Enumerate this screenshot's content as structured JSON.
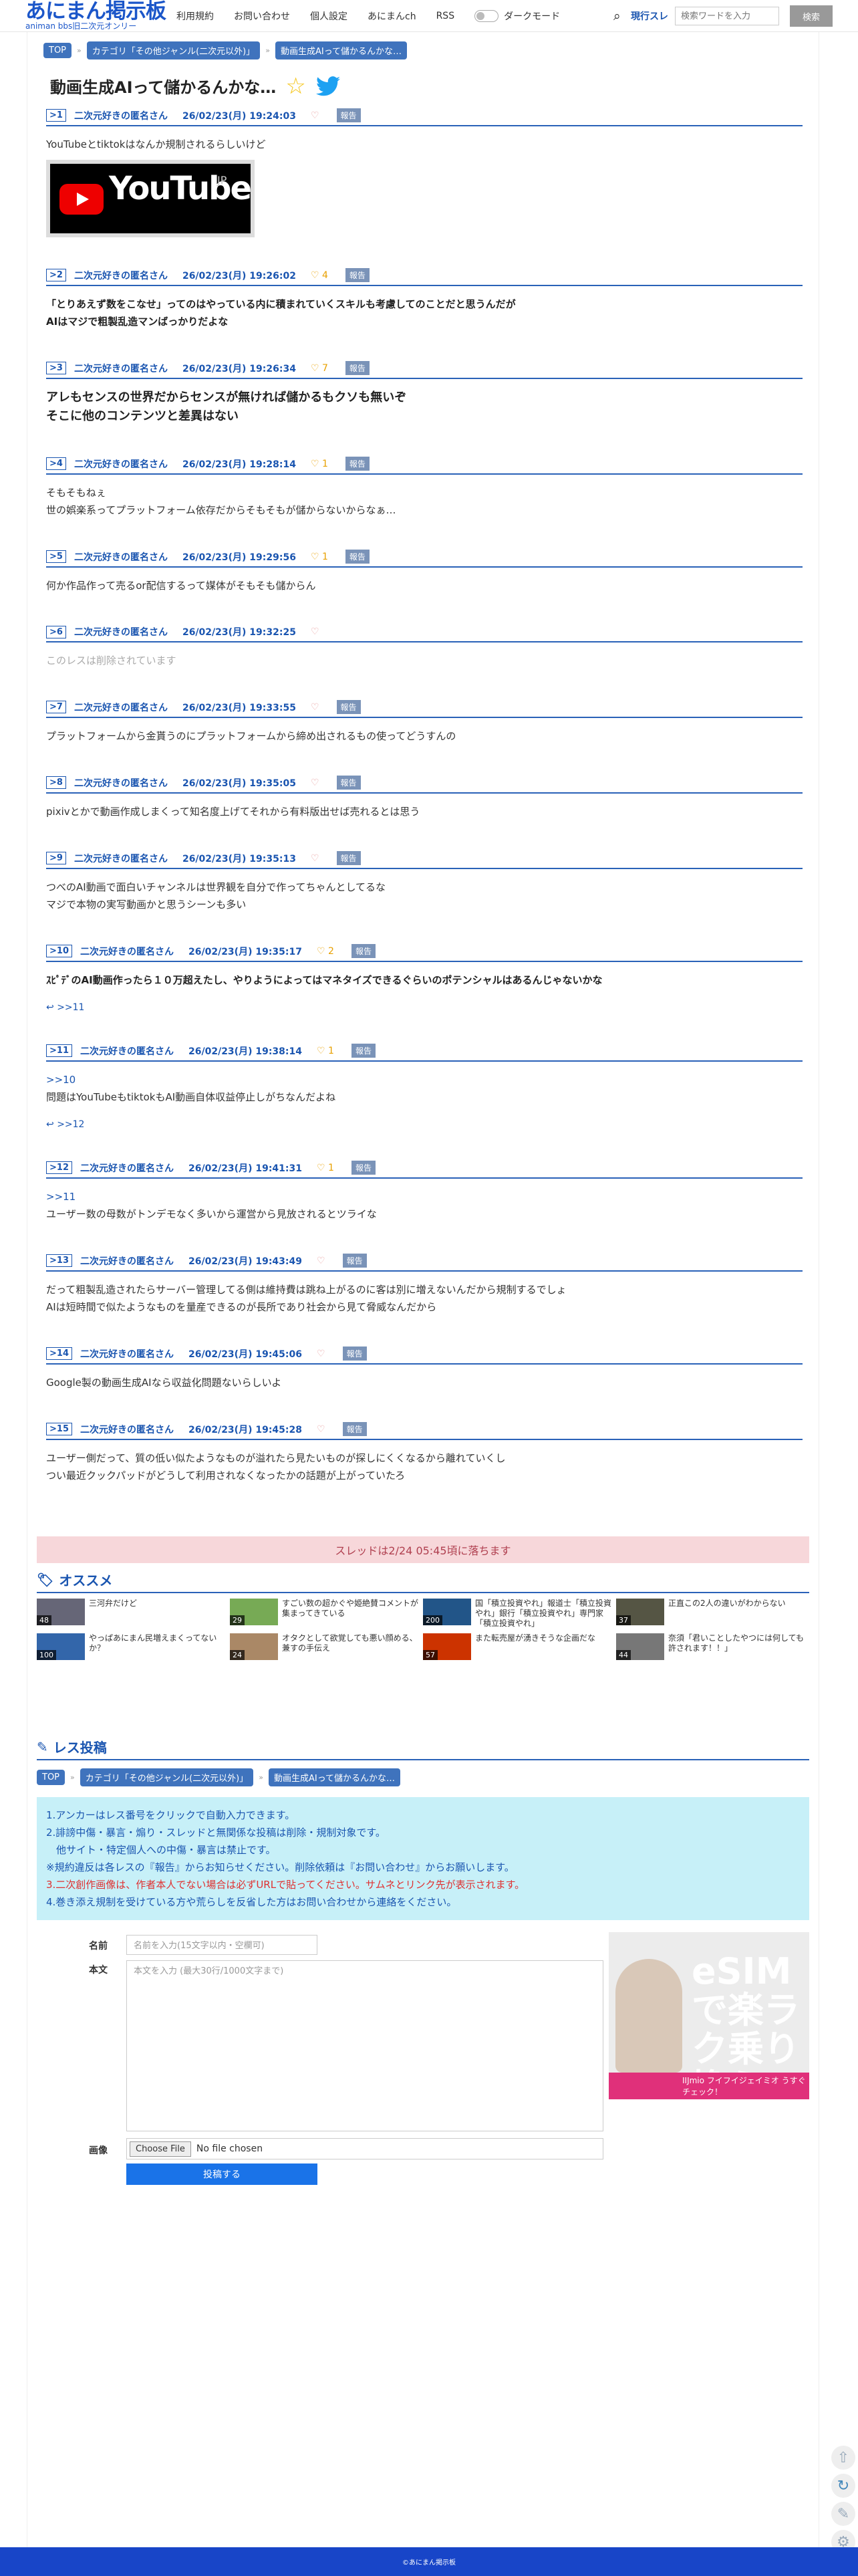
{
  "header": {
    "logo_main": "あにまん掲示板",
    "logo_sub": "animan bbs旧二次元オンリー",
    "nav": [
      "利用規約",
      "お問い合わせ",
      "個人設定",
      "あにまんch",
      "RSS"
    ],
    "dark_mode": "ダークモード",
    "search_scope": "現行スレ",
    "search_placeholder": "検索ワードを入力",
    "search_button": "検索"
  },
  "breadcrumb": [
    "TOP",
    "カテゴリ「その他ジャンル(二次元以外)」",
    "動画生成AIって儲かるんかな…"
  ],
  "breadcrumb_sep": "»",
  "thread_title": "動画生成AIって儲かるんかな…",
  "posts": [
    {
      "num": "1",
      "name": "二次元好きの匿名さん",
      "time": "26/02/23(月) 19:24:03",
      "likes": "",
      "report": "報告",
      "anchor": "",
      "lines": [
        "YouTubeとtiktokはなんか規制されるらしいけど"
      ],
      "image": {
        "brand": "YouTube",
        "region": "JP"
      }
    },
    {
      "num": "2",
      "name": "二次元好きの匿名さん",
      "time": "26/02/23(月) 19:26:02",
      "likes": "4",
      "report": "報告",
      "anchor": "",
      "lines": [
        "「とりあえず数をこなせ」ってのはやっている内に積まれていくスキルも考慮してのことだと思うんだが",
        "AIはマジで粗製乱造マンばっかりだよな"
      ]
    },
    {
      "num": "3",
      "name": "二次元好きの匿名さん",
      "time": "26/02/23(月) 19:26:34",
      "likes": "7",
      "report": "報告",
      "anchor": "",
      "lines": [
        "アレもセンスの世界だからセンスが無ければ儲かるもクソも無いぞ",
        "そこに他のコンテンツと差異はない"
      ]
    },
    {
      "num": "4",
      "name": "二次元好きの匿名さん",
      "time": "26/02/23(月) 19:28:14",
      "likes": "1",
      "report": "報告",
      "anchor": "",
      "lines": [
        "そもそもねぇ",
        "世の娯楽系ってプラットフォーム依存だからそもそもが儲からないからなぁ…"
      ]
    },
    {
      "num": "5",
      "name": "二次元好きの匿名さん",
      "time": "26/02/23(月) 19:29:56",
      "likes": "1",
      "report": "報告",
      "anchor": "",
      "lines": [
        "何か作品作って売るor配信するって媒体がそもそも儲からん"
      ]
    },
    {
      "num": "6",
      "name": "二次元好きの匿名さん",
      "time": "26/02/23(月) 19:32:25",
      "likes": "",
      "report": "",
      "anchor": "",
      "lines": [
        "このレスは削除されています"
      ]
    },
    {
      "num": "7",
      "name": "二次元好きの匿名さん",
      "time": "26/02/23(月) 19:33:55",
      "likes": "",
      "report": "報告",
      "anchor": "",
      "lines": [
        "プラットフォームから金貰うのにプラットフォームから締め出されるもの使ってどうすんの"
      ]
    },
    {
      "num": "8",
      "name": "二次元好きの匿名さん",
      "time": "26/02/23(月) 19:35:05",
      "likes": "",
      "report": "報告",
      "anchor": "",
      "lines": [
        "pixivとかで動画作成しまくって知名度上げてそれから有料版出せば売れるとは思う"
      ]
    },
    {
      "num": "9",
      "name": "二次元好きの匿名さん",
      "time": "26/02/23(月) 19:35:13",
      "likes": "",
      "report": "報告",
      "anchor": "",
      "lines": [
        "つべのAI動画で面白いチャンネルは世界観を自分で作ってちゃんとしてるな",
        "マジで本物の実写動画かと思うシーンも多い"
      ]
    },
    {
      "num": "10",
      "name": "二次元好きの匿名さん",
      "time": "26/02/23(月) 19:35:17",
      "likes": "2",
      "report": "報告",
      "anchor": "",
      "lines": [
        "ｽﾋﾟﾃﾞのAI動画作ったら１０万超えたし、やりようによってはマネタイズできるぐらいのポテンシャルはあるんじゃないかな"
      ],
      "reply": ">>11"
    },
    {
      "num": "11",
      "name": "二次元好きの匿名さん",
      "time": "26/02/23(月) 19:38:14",
      "likes": "1",
      "report": "報告",
      "anchor": ">>10",
      "lines": [
        "問題はYouTubeもtiktokもAI動画自体収益停止しがちなんだよね"
      ],
      "reply": ">>12"
    },
    {
      "num": "12",
      "name": "二次元好きの匿名さん",
      "time": "26/02/23(月) 19:41:31",
      "likes": "1",
      "report": "報告",
      "anchor": ">>11",
      "lines": [
        "ユーザー数の母数がトンデモなく多いから運営から見放されるとツライな"
      ]
    },
    {
      "num": "13",
      "name": "二次元好きの匿名さん",
      "time": "26/02/23(月) 19:43:49",
      "likes": "",
      "report": "報告",
      "anchor": "",
      "lines": [
        "だって粗製乱造されたらサーバー管理してる側は維持費は跳ね上がるのに客は別に増えないんだから規制するでしょ",
        "AIは短時間で似たようなものを量産できるのが長所であり社会から見て脅威なんだから"
      ]
    },
    {
      "num": "14",
      "name": "二次元好きの匿名さん",
      "time": "26/02/23(月) 19:45:06",
      "likes": "",
      "report": "報告",
      "anchor": "",
      "lines": [
        "Google製の動画生成AIなら収益化問題ないらしいよ"
      ]
    },
    {
      "num": "15",
      "name": "二次元好きの匿名さん",
      "time": "26/02/23(月) 19:45:28",
      "likes": "",
      "report": "報告",
      "anchor": "",
      "lines": [
        "ユーザー側だって、質の低い似たようなものが溢れたら見たいものが探しにくくなるから離れていくし",
        "つい最近クックパッドがどうして利用されなくなったかの話題が上がっていたろ"
      ]
    }
  ],
  "notice": "スレッドは2/24 05:45頃に落ちます",
  "recommend": {
    "title": "オススメ",
    "items": [
      {
        "text": "三河弁だけど",
        "count": "48"
      },
      {
        "text": "すごい数の超かぐや姫絶賛コメントが集まってきている",
        "count": "29"
      },
      {
        "text": "国「積立投資やれ」報道士「積立投資やれ」銀行「積立投資やれ」専門家「積立投資やれ」",
        "count": "200"
      },
      {
        "text": "正直この2人の違いがわからない",
        "count": "37"
      },
      {
        "text": "やっぱあにまん民増えまくってないか？",
        "count": "100"
      },
      {
        "text": "オタクとして欲覚しても悪い顔める、兼すの手伝え",
        "count": "24"
      },
      {
        "text": "また転売屋が湧きそうな企画だな",
        "count": "57"
      },
      {
        "text": "奈須「君いことしたやつには何しても許されます！！」",
        "count": "44"
      }
    ]
  },
  "post_form": {
    "title": "レス投稿",
    "rules": [
      "1.アンカーはレス番号をクリックで自動入力できます。",
      "2.誹謗中傷・暴言・煽り・スレッドと無関係な投稿は削除・規制対象です。",
      "　他サイト・特定個人への中傷・暴言は禁止です。",
      "※規約違反は各レスの『報告』からお知らせください。削除依頼は『お問い合わせ』からお願いします。",
      "3.二次創作画像は、作者本人でない場合は必ずURLで貼ってください。サムネとリンク先が表示されます。",
      "4.巻き添え規制を受けている方や荒らしを反省した方はお問い合わせから連絡をください。"
    ],
    "name_label": "名前",
    "name_placeholder": "名前を入力(15文字以内・空欄可)",
    "body_label": "本文",
    "body_placeholder": "本文を入力 (最大30行/1000文字まで)",
    "image_label": "画像",
    "file_button": "Choose File",
    "file_status": "No file chosen",
    "submit": "投稿する"
  },
  "ad": {
    "headline": "eSIMで楽ラク乗り換え",
    "brand": "IIJmio",
    "footer": "IIJmio フイフイジェイミオ うすぐチェック！"
  },
  "footer": "©あにまん掲示板",
  "colors": {
    "accent": "#1a55b0",
    "notice_bg": "#f7d7da",
    "rules_bg": "#c7f0f8",
    "footer_bg": "#1845c8"
  }
}
